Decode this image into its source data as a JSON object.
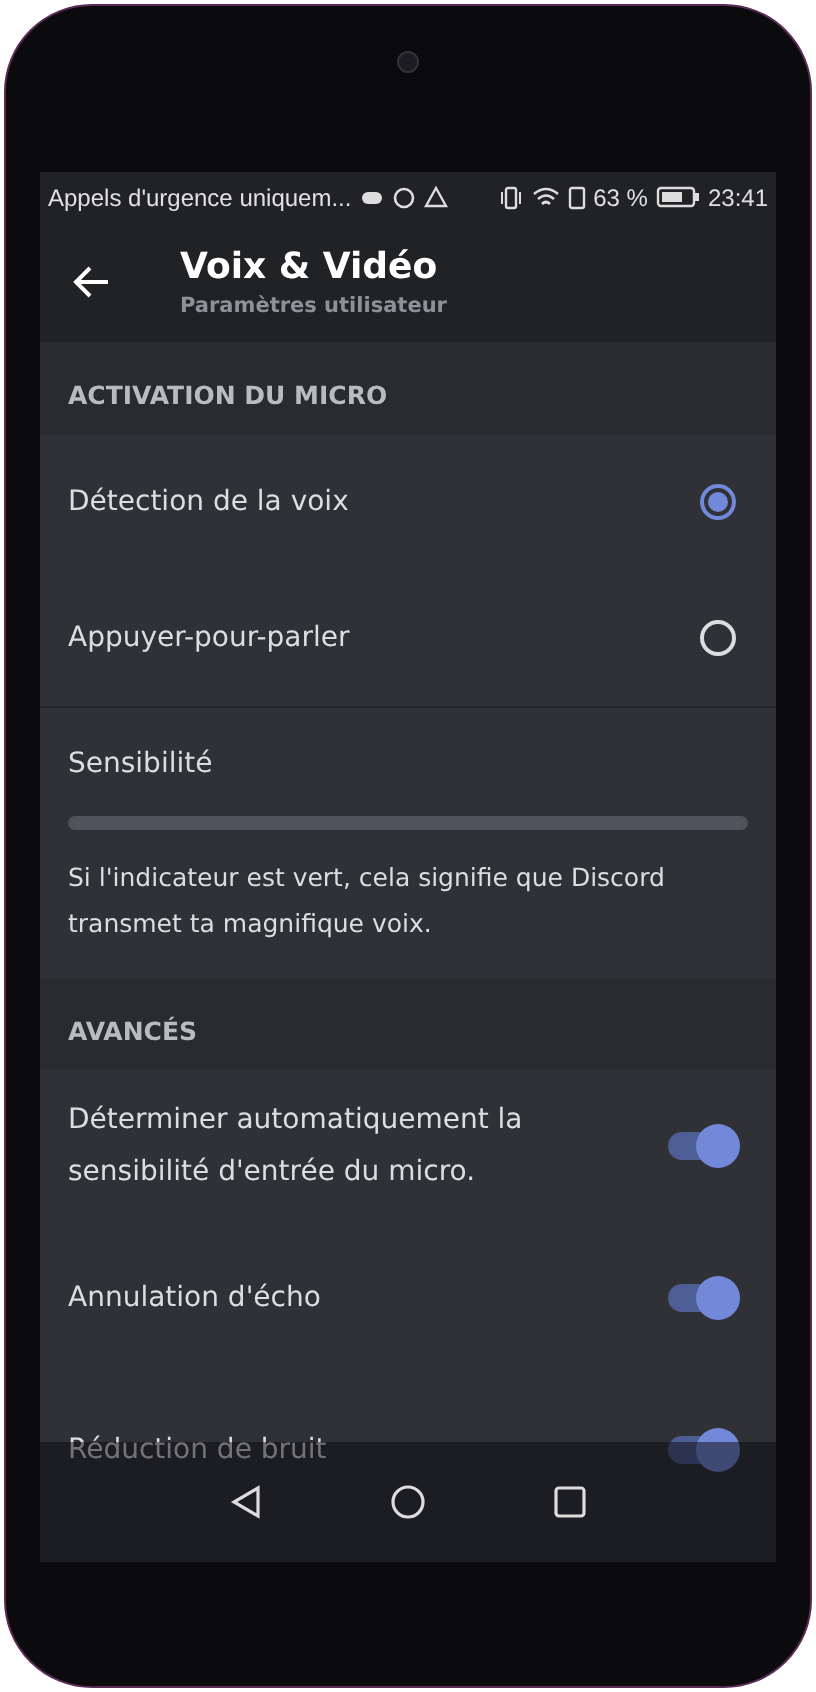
{
  "status_bar": {
    "notification": "Appels d'urgence uniquem...",
    "battery": "63 %",
    "time": "23:41"
  },
  "header": {
    "title": "Voix & Vidéo",
    "subtitle": "Paramètres utilisateur"
  },
  "sections": [
    {
      "title": "ACTIVATION DU MICRO",
      "items": [
        {
          "kind": "radio",
          "label": "Détection de la voix",
          "selected": true
        },
        {
          "kind": "radio",
          "label": "Appuyer-pour-parler",
          "selected": false
        },
        {
          "kind": "meter",
          "label": "Sensibilité",
          "description": "Si l'indicateur est vert, cela signifie que Discord transmet ta magnifique voix."
        }
      ]
    },
    {
      "title": "AVANCÉS",
      "items": [
        {
          "kind": "toggle",
          "label": "Déterminer automatiquement la sensibilité d'entrée du micro.",
          "on": true
        },
        {
          "kind": "toggle",
          "label": "Annulation d'écho",
          "on": true
        },
        {
          "kind": "toggle",
          "label": "Réduction de bruit",
          "on": true
        }
      ]
    }
  ]
}
